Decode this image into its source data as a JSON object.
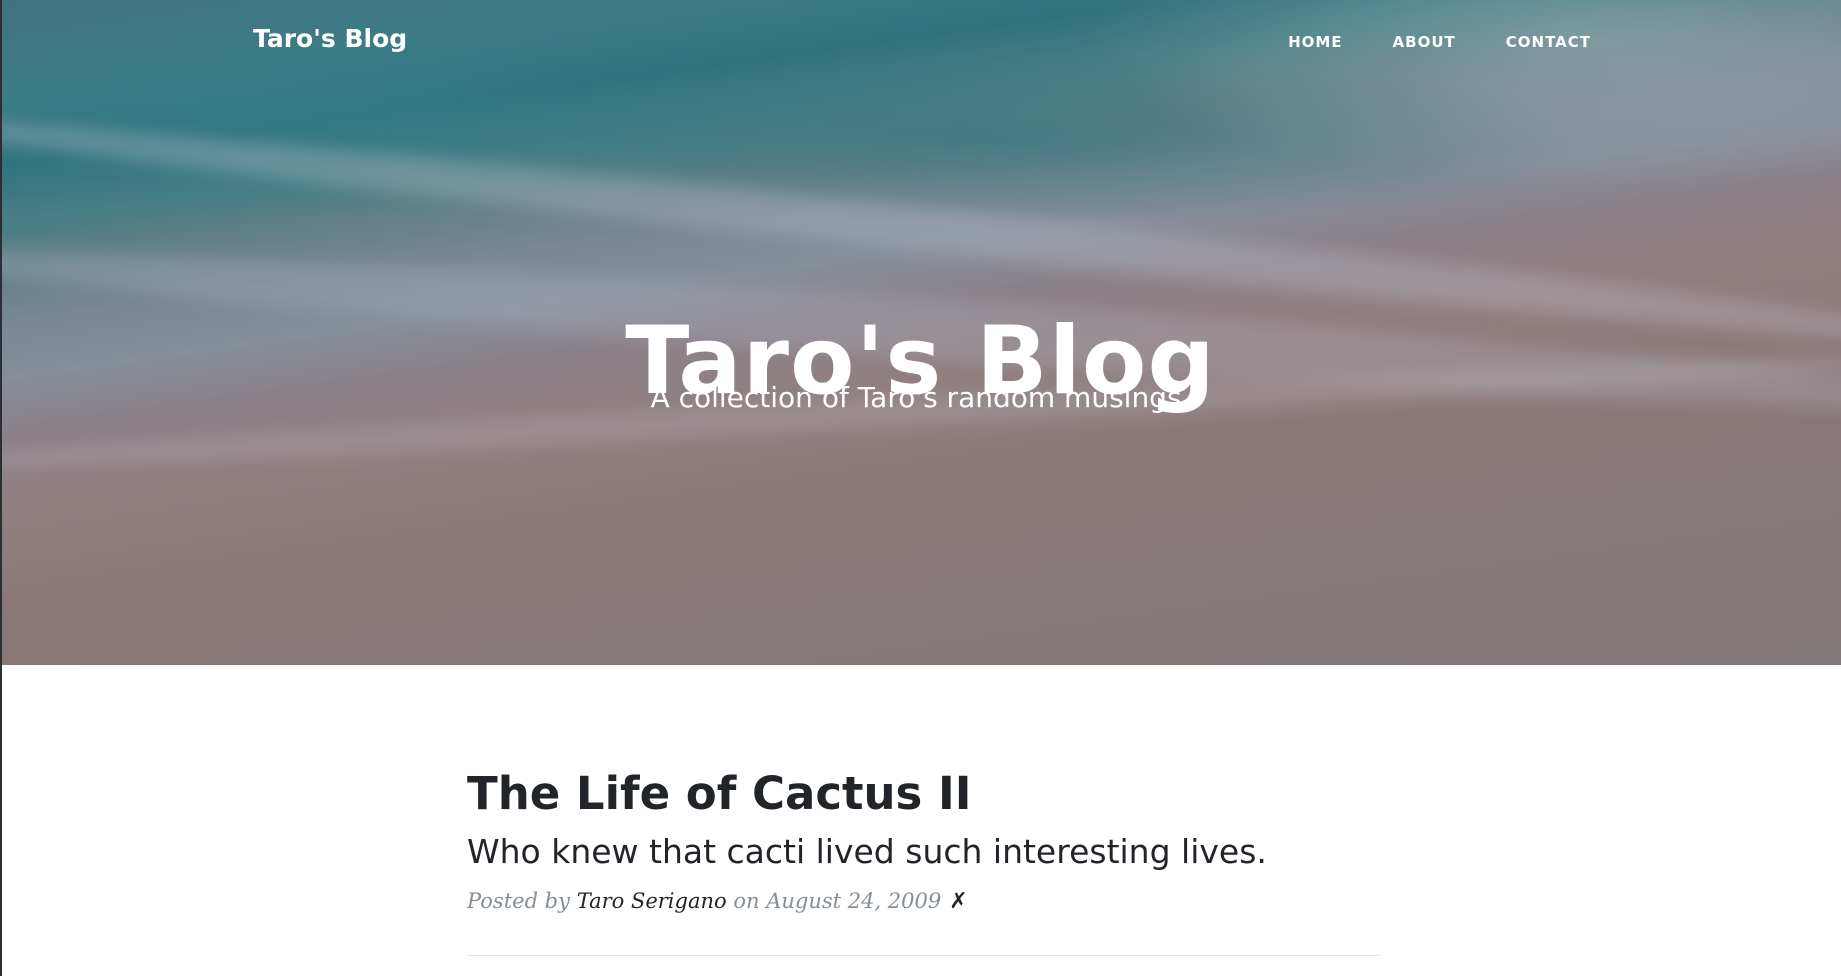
{
  "nav": {
    "brand": "Taro's Blog",
    "links": [
      "HOME",
      "ABOUT",
      "CONTACT"
    ]
  },
  "hero": {
    "title": "Taro's Blog",
    "subtitle": "A collection of Taro's random musings."
  },
  "post": {
    "title": "The Life of Cactus II",
    "subtitle": "Who knew that cacti lived such interesting lives.",
    "meta_prefix": "Posted by",
    "author": "Taro Serigano",
    "meta_date_prefix": "on",
    "date": "August 24, 2009",
    "delete_glyph": "✗"
  },
  "colors": {
    "heading": "#212529",
    "meta": "#868e96",
    "divider": "#dee2e6",
    "hero_text": "#ffffff"
  },
  "icons": {
    "delete": "x-icon"
  }
}
